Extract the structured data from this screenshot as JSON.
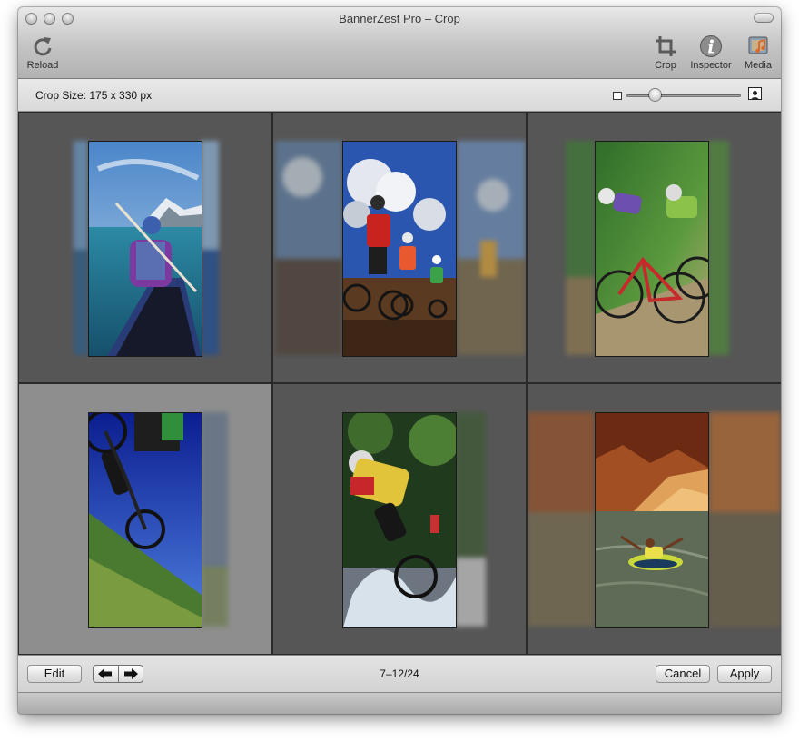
{
  "window": {
    "title": "BannerZest Pro – Crop"
  },
  "toolbar": {
    "reload_label": "Reload",
    "crop_label": "Crop",
    "inspector_label": "Inspector",
    "media_label": "Media"
  },
  "info": {
    "crop_size": "Crop Size: 175 x 330 px"
  },
  "zoom": {
    "level": 0.2
  },
  "photos": [
    {
      "subject": "kayaker on mountain lake",
      "selected": false
    },
    {
      "subject": "family cycling on trail",
      "selected": false
    },
    {
      "subject": "two mountain bikers racing",
      "selected": false
    },
    {
      "subject": "mountain biker jumping downhill",
      "selected": true
    },
    {
      "subject": "mountain biker splashing through water",
      "selected": false
    },
    {
      "subject": "tubing on canyon lake",
      "selected": false
    }
  ],
  "footer": {
    "edit_label": "Edit",
    "prev_icon": "arrow-left-icon",
    "next_icon": "arrow-right-icon",
    "page_range": "7–12/24",
    "cancel_label": "Cancel",
    "apply_label": "Apply"
  }
}
